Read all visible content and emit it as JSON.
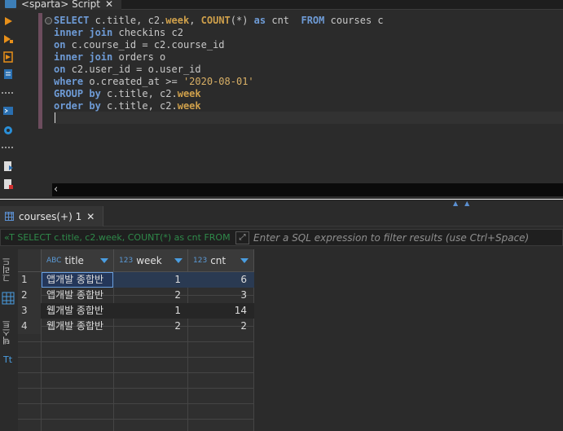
{
  "editor_tab": {
    "title": "<sparta> Script",
    "close": "✕"
  },
  "sql_lines": [
    "SELECT c.title, c2.week, COUNT(*) as cnt  FROM courses c",
    "inner join checkins c2",
    "on c.course_id = c2.course_id",
    "inner join orders o",
    "on c2.user_id = o.user_id",
    "where o.created_at >= '2020-08-01'",
    "GROUP by c.title, c2.week",
    "order by c.title, c2.week"
  ],
  "results_tab": {
    "label": "courses(+) 1",
    "close": "✕"
  },
  "filter": {
    "query_prefix": "«T",
    "query": "SELECT c.title, c2.week, COUNT(*) as cnt FROM",
    "placeholder": "Enter a SQL expression to filter results (use Ctrl+Space)"
  },
  "view_tabs": {
    "grid": "그리드",
    "text": "텍스트"
  },
  "grid": {
    "columns": [
      {
        "type_label": "ABC",
        "name": "title"
      },
      {
        "type_label": "123",
        "name": "week"
      },
      {
        "type_label": "123",
        "name": "cnt"
      }
    ],
    "rows": [
      {
        "num": "1",
        "title": "앱개발 종합반",
        "week": "1",
        "cnt": "6"
      },
      {
        "num": "2",
        "title": "앱개발 종합반",
        "week": "2",
        "cnt": "3"
      },
      {
        "num": "3",
        "title": "웹개발 종합반",
        "week": "1",
        "cnt": "14"
      },
      {
        "num": "4",
        "title": "웹개발 종합반",
        "week": "2",
        "cnt": "2"
      }
    ]
  },
  "accent_color": "#4a9de0"
}
